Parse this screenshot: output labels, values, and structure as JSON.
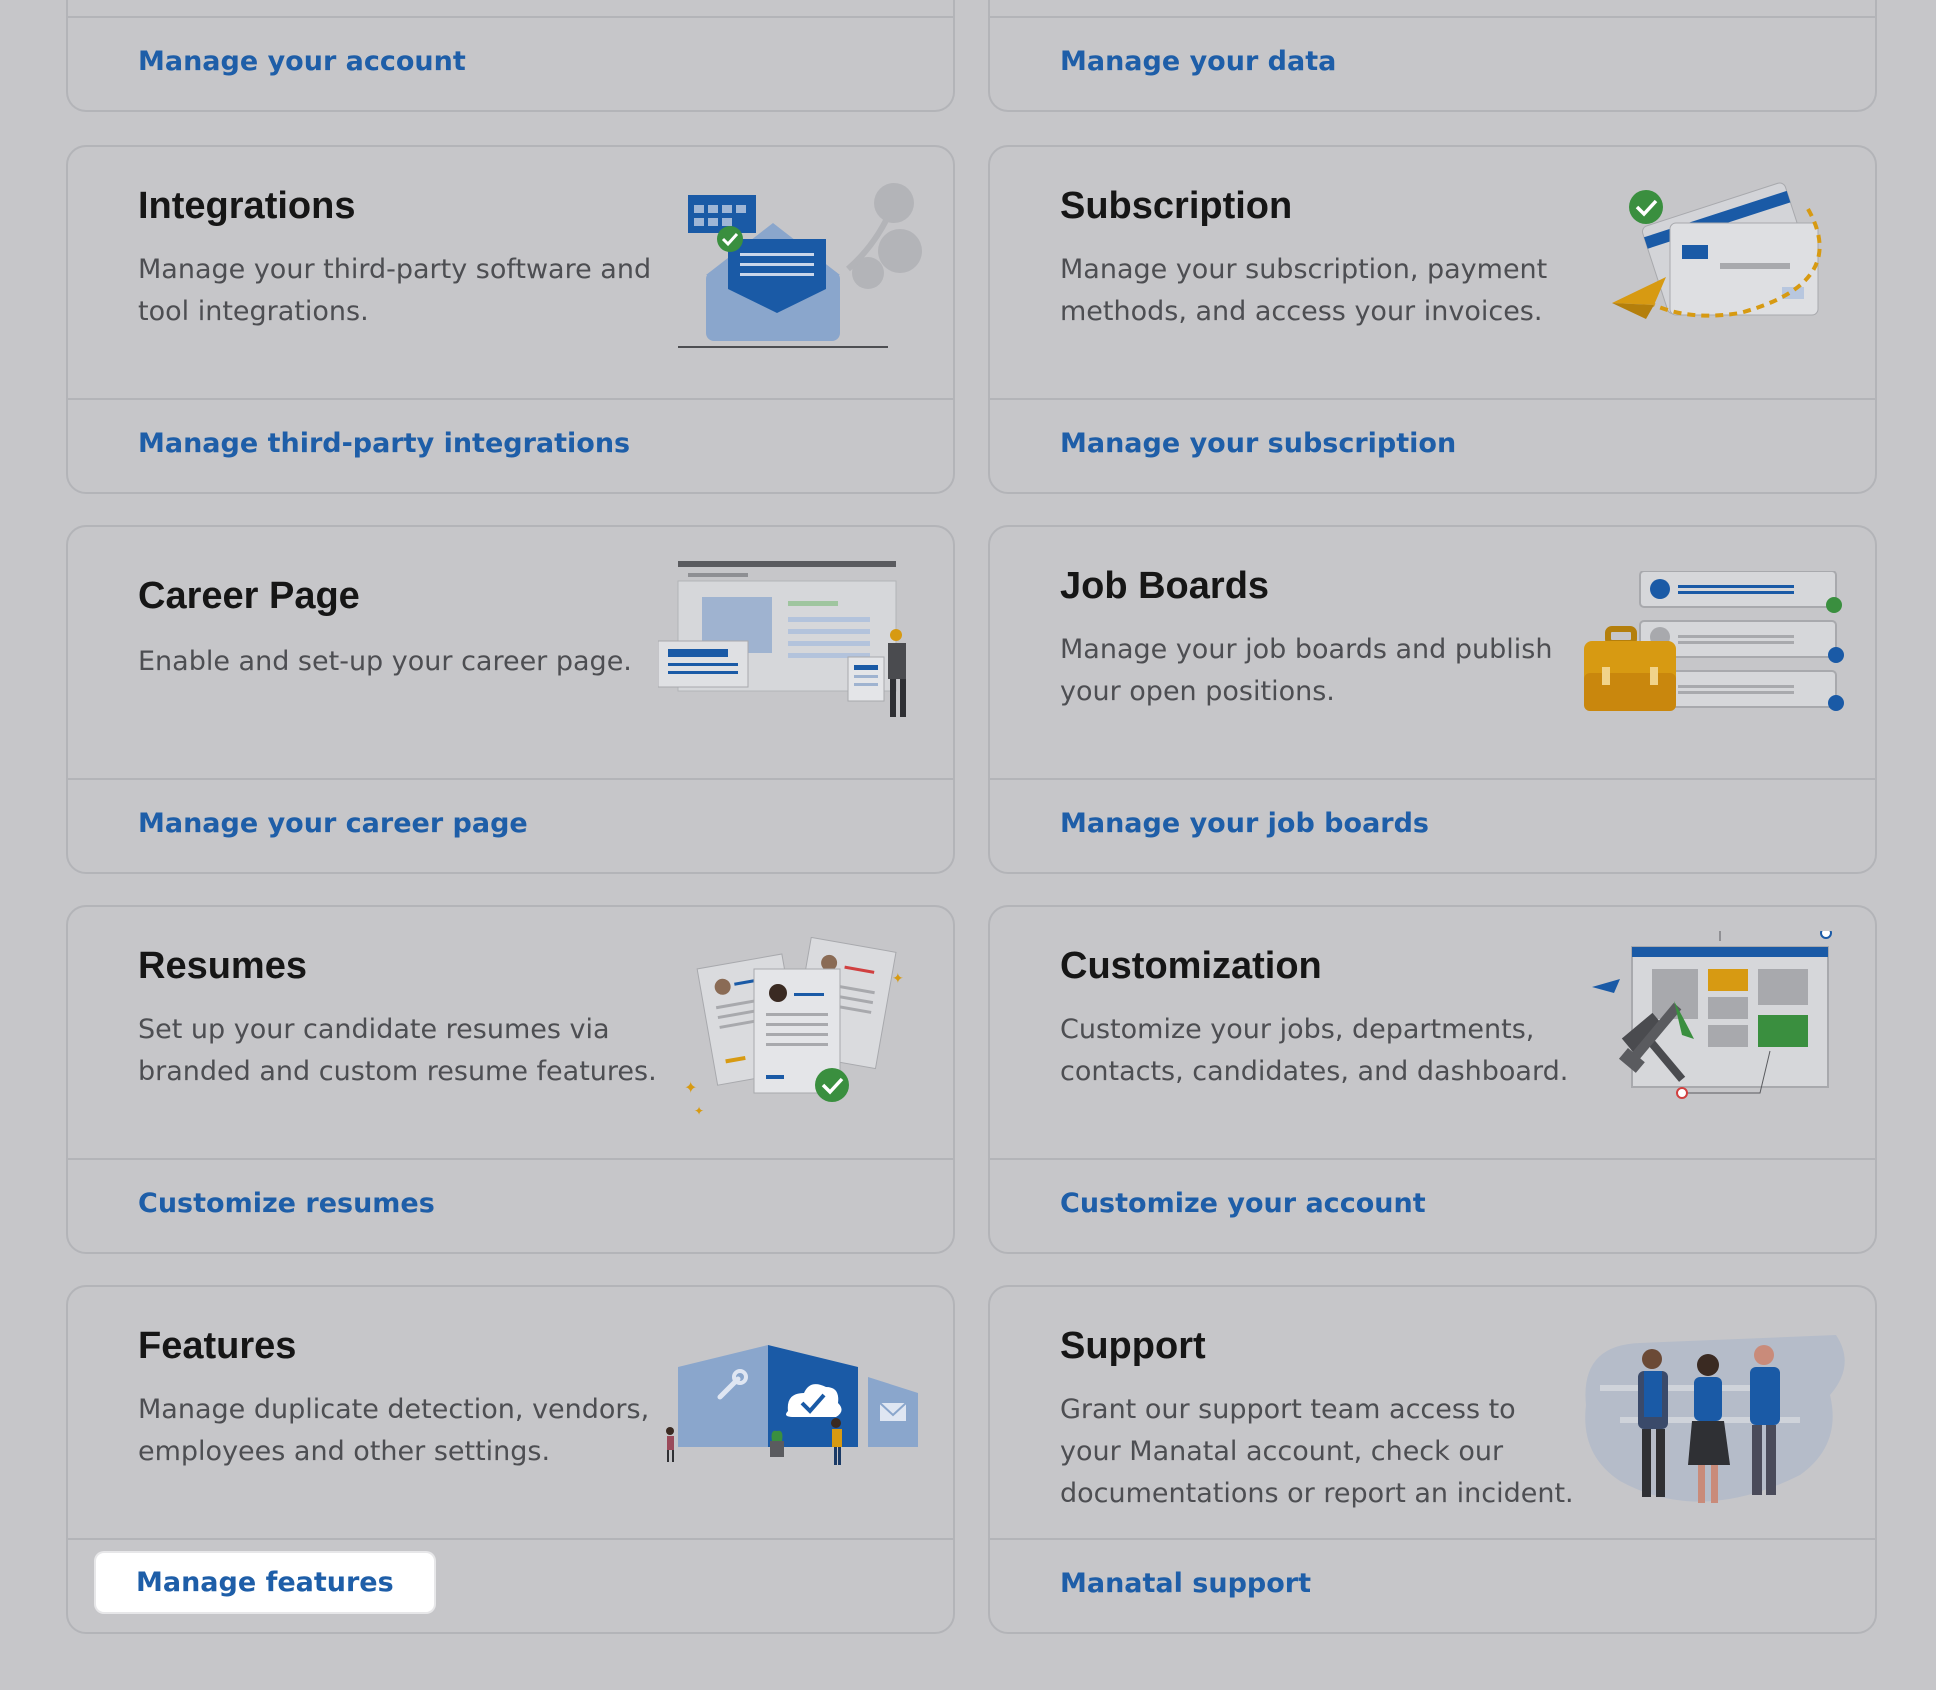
{
  "top_cards": [
    {
      "link": "Manage your account"
    },
    {
      "link": "Manage your data"
    }
  ],
  "cards": [
    {
      "title": "Integrations",
      "desc": "Manage your third-party software and tool integrations.",
      "link": "Manage third-party integrations"
    },
    {
      "title": "Subscription",
      "desc": "Manage your subscription, payment methods, and access your invoices.",
      "link": "Manage your subscription"
    },
    {
      "title": "Career Page",
      "desc": "Enable and set-up your career page.",
      "link": "Manage your career page"
    },
    {
      "title": "Job Boards",
      "desc": "Manage your job boards and publish your open positions.",
      "link": "Manage your job boards"
    },
    {
      "title": "Resumes",
      "desc": "Set up your candidate resumes via branded and custom resume features.",
      "link": "Customize resumes"
    },
    {
      "title": "Customization",
      "desc": "Customize your jobs, departments, contacts, candidates, and dashboard.",
      "link": "Customize your account"
    },
    {
      "title": "Features",
      "desc": "Manage duplicate detection, vendors, employees and other settings.",
      "link": "Manage features"
    },
    {
      "title": "Support",
      "desc": "Grant our support team access to your Manatal account, check our documentations or report an incident.",
      "link": "Manatal support"
    }
  ],
  "colors": {
    "background": "#c6c6c9",
    "link": "#1e5ea8",
    "title": "#161616",
    "description": "#4d4e52",
    "border": "#b3b4b8",
    "illustration_blue": "#1a5aa6",
    "illustration_green": "#3a8f3f",
    "illustration_yellow": "#d79a12"
  },
  "icons": [
    "integrations-envelope-illustration",
    "subscription-card-illustration",
    "career-page-illustration",
    "job-boards-illustration",
    "resumes-illustration",
    "customization-illustration",
    "features-building-illustration",
    "support-team-illustration"
  ]
}
